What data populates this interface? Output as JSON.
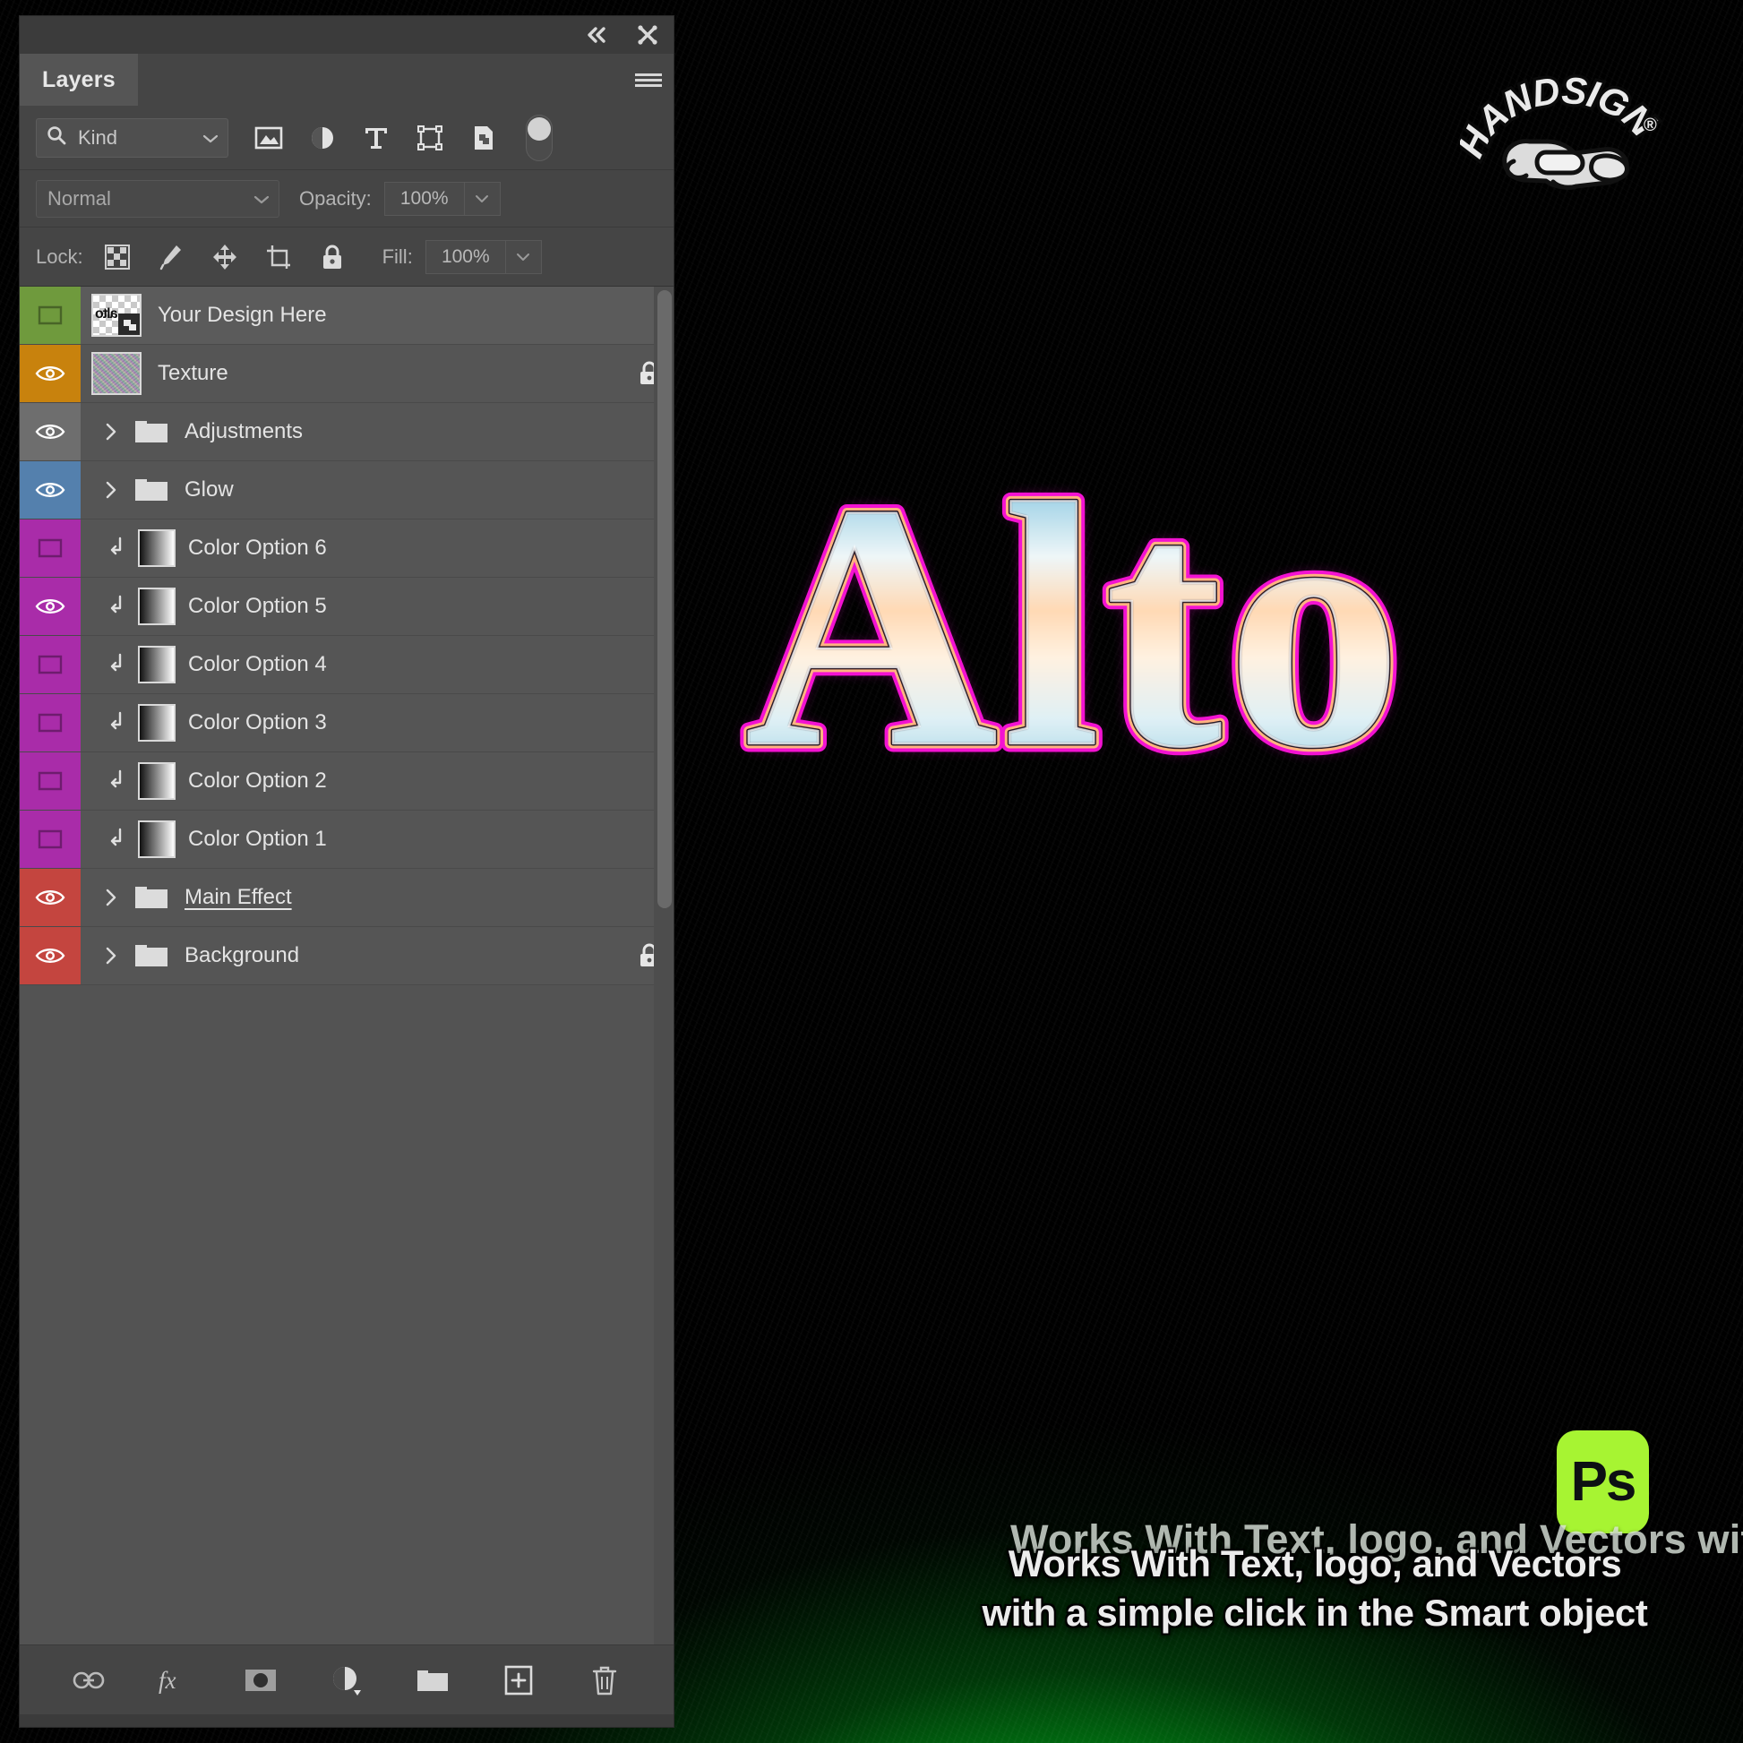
{
  "panel": {
    "topbar": {
      "collapse_icon": "double-chevron-left-icon",
      "close_icon": "close-icon"
    },
    "tab_label": "Layers",
    "menu_icon": "hamburger-menu-icon",
    "filter": {
      "kind_label": "Kind",
      "search_icon": "search-icon",
      "icons": [
        "image-filter-icon",
        "adjustment-filter-icon",
        "type-filter-icon",
        "shape-filter-icon",
        "smart-object-filter-icon"
      ],
      "toggle_icon": "filter-enable-toggle"
    },
    "blend": {
      "mode": "Normal",
      "opacity_label": "Opacity:",
      "opacity_value": "100%"
    },
    "lock": {
      "label": "Lock:",
      "icons": [
        "lock-transparent-pixels-icon",
        "lock-image-pixels-icon",
        "lock-position-icon",
        "lock-artboard-nesting-icon",
        "lock-all-icon"
      ],
      "fill_label": "Fill:",
      "fill_value": "100%"
    },
    "layers": [
      {
        "name": "Your Design Here",
        "swatch": "#6f9a3d",
        "visible": false,
        "thumb": "checker",
        "thumb_text": "alto",
        "kind": "smart-object",
        "indent": 0,
        "locked": false,
        "selected": true,
        "underlined": false
      },
      {
        "name": "Texture",
        "swatch": "#c8820d",
        "visible": true,
        "thumb": "noise",
        "kind": "raster",
        "indent": 0,
        "locked": true,
        "selected": false,
        "underlined": false
      },
      {
        "name": "Adjustments",
        "swatch": "#6e6e6e",
        "visible": true,
        "thumb": "none",
        "kind": "group",
        "indent": 0,
        "locked": false,
        "selected": false,
        "underlined": false
      },
      {
        "name": "Glow",
        "swatch": "#5480ad",
        "visible": true,
        "thumb": "none",
        "kind": "group",
        "indent": 0,
        "locked": false,
        "selected": false,
        "underlined": false
      },
      {
        "name": "Color Option 6",
        "swatch": "#a92ca9",
        "visible": false,
        "thumb": "grad",
        "kind": "clipped",
        "indent": 1,
        "locked": false,
        "selected": false,
        "underlined": false
      },
      {
        "name": "Color Option 5",
        "swatch": "#a92ca9",
        "visible": true,
        "thumb": "grad",
        "kind": "clipped",
        "indent": 1,
        "locked": false,
        "selected": false,
        "underlined": false
      },
      {
        "name": "Color Option 4",
        "swatch": "#a92ca9",
        "visible": false,
        "thumb": "grad",
        "kind": "clipped",
        "indent": 1,
        "locked": false,
        "selected": false,
        "underlined": false
      },
      {
        "name": "Color Option 3",
        "swatch": "#a92ca9",
        "visible": false,
        "thumb": "grad",
        "kind": "clipped",
        "indent": 1,
        "locked": false,
        "selected": false,
        "underlined": false
      },
      {
        "name": "Color Option 2",
        "swatch": "#a92ca9",
        "visible": false,
        "thumb": "grad",
        "kind": "clipped",
        "indent": 1,
        "locked": false,
        "selected": false,
        "underlined": false
      },
      {
        "name": "Color Option 1",
        "swatch": "#a92ca9",
        "visible": false,
        "thumb": "grad",
        "kind": "clipped",
        "indent": 1,
        "locked": false,
        "selected": false,
        "underlined": false
      },
      {
        "name": "Main Effect ",
        "swatch": "#c4453f",
        "visible": true,
        "thumb": "none",
        "kind": "group",
        "indent": 0,
        "locked": false,
        "selected": false,
        "underlined": true
      },
      {
        "name": "Background",
        "swatch": "#c4453f",
        "visible": true,
        "thumb": "none",
        "kind": "group",
        "indent": 0,
        "locked": true,
        "selected": false,
        "underlined": false
      }
    ],
    "bottom_icons": [
      "link-layers-icon",
      "layer-style-fx-icon",
      "add-layer-mask-icon",
      "new-adjustment-layer-icon",
      "new-group-icon",
      "new-layer-icon",
      "delete-layer-icon"
    ]
  },
  "canvas": {
    "logo_text": "HANDSIGN",
    "logo_mark": "®",
    "logo_icon": "pointing-hand-icon",
    "artwork_text": "Alto",
    "ps_badge_label": "Ps",
    "ghost_text": "Works With Text, logo, and Vectors  wit",
    "caption_line1": "Works With Text, logo, and Vectors",
    "caption_line2": "with a simple click in the Smart object"
  },
  "colors": {
    "ps_green": "#a7f432",
    "panel_bg": "#3b3b3b",
    "row_bg": "#555555",
    "header_bg": "#454545",
    "accent_glow_green": "#00d030"
  }
}
